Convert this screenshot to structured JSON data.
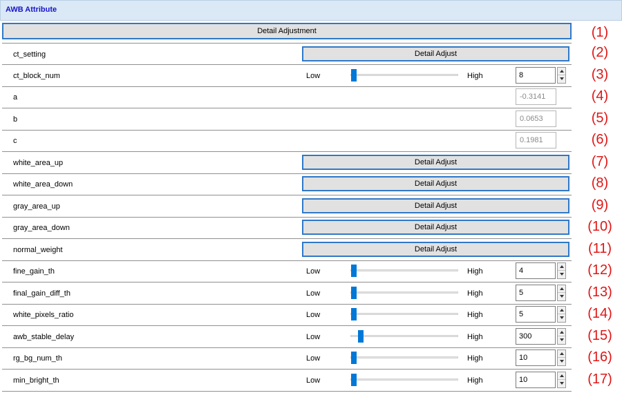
{
  "header": {
    "title": "AWB Attribute"
  },
  "main_button": {
    "label": "Detail Adjustment",
    "number": "(1)"
  },
  "low_label": "Low",
  "high_label": "High",
  "rows": [
    {
      "label": "ct_setting",
      "type": "button",
      "button_label": "Detail Adjust",
      "number": "(2)"
    },
    {
      "label": "ct_block_num",
      "type": "slider",
      "value": "8",
      "position": 0.0,
      "number": "(3)"
    },
    {
      "label": "a",
      "type": "readonly",
      "value": "-0.3141",
      "number": "(4)"
    },
    {
      "label": "b",
      "type": "readonly",
      "value": "0.0653",
      "number": "(5)"
    },
    {
      "label": "c",
      "type": "readonly",
      "value": "0.1981",
      "number": "(6)"
    },
    {
      "label": "white_area_up",
      "type": "button",
      "button_label": "Detail Adjust",
      "number": "(7)"
    },
    {
      "label": "white_area_down",
      "type": "button",
      "button_label": "Detail Adjust",
      "number": "(8)"
    },
    {
      "label": "gray_area_up",
      "type": "button",
      "button_label": "Detail Adjust",
      "number": "(9)"
    },
    {
      "label": "gray_area_down",
      "type": "button",
      "button_label": "Detail Adjust",
      "number": "(10)"
    },
    {
      "label": "normal_weight",
      "type": "button",
      "button_label": "Detail Adjust",
      "number": "(11)"
    },
    {
      "label": "fine_gain_th",
      "type": "slider",
      "value": "4",
      "position": 0.0,
      "number": "(12)"
    },
    {
      "label": "final_gain_diff_th",
      "type": "slider",
      "value": "5",
      "position": 0.0,
      "number": "(13)"
    },
    {
      "label": "white_pixels_ratio",
      "type": "slider",
      "value": "5",
      "position": 0.0,
      "number": "(14)"
    },
    {
      "label": "awb_stable_delay",
      "type": "slider",
      "value": "300",
      "position": 0.07,
      "number": "(15)"
    },
    {
      "label": "rg_bg_num_th",
      "type": "slider",
      "value": "10",
      "position": 0.0,
      "number": "(16)"
    },
    {
      "label": "min_bright_th",
      "type": "slider",
      "value": "10",
      "position": 0.0,
      "number": "(17)"
    }
  ]
}
